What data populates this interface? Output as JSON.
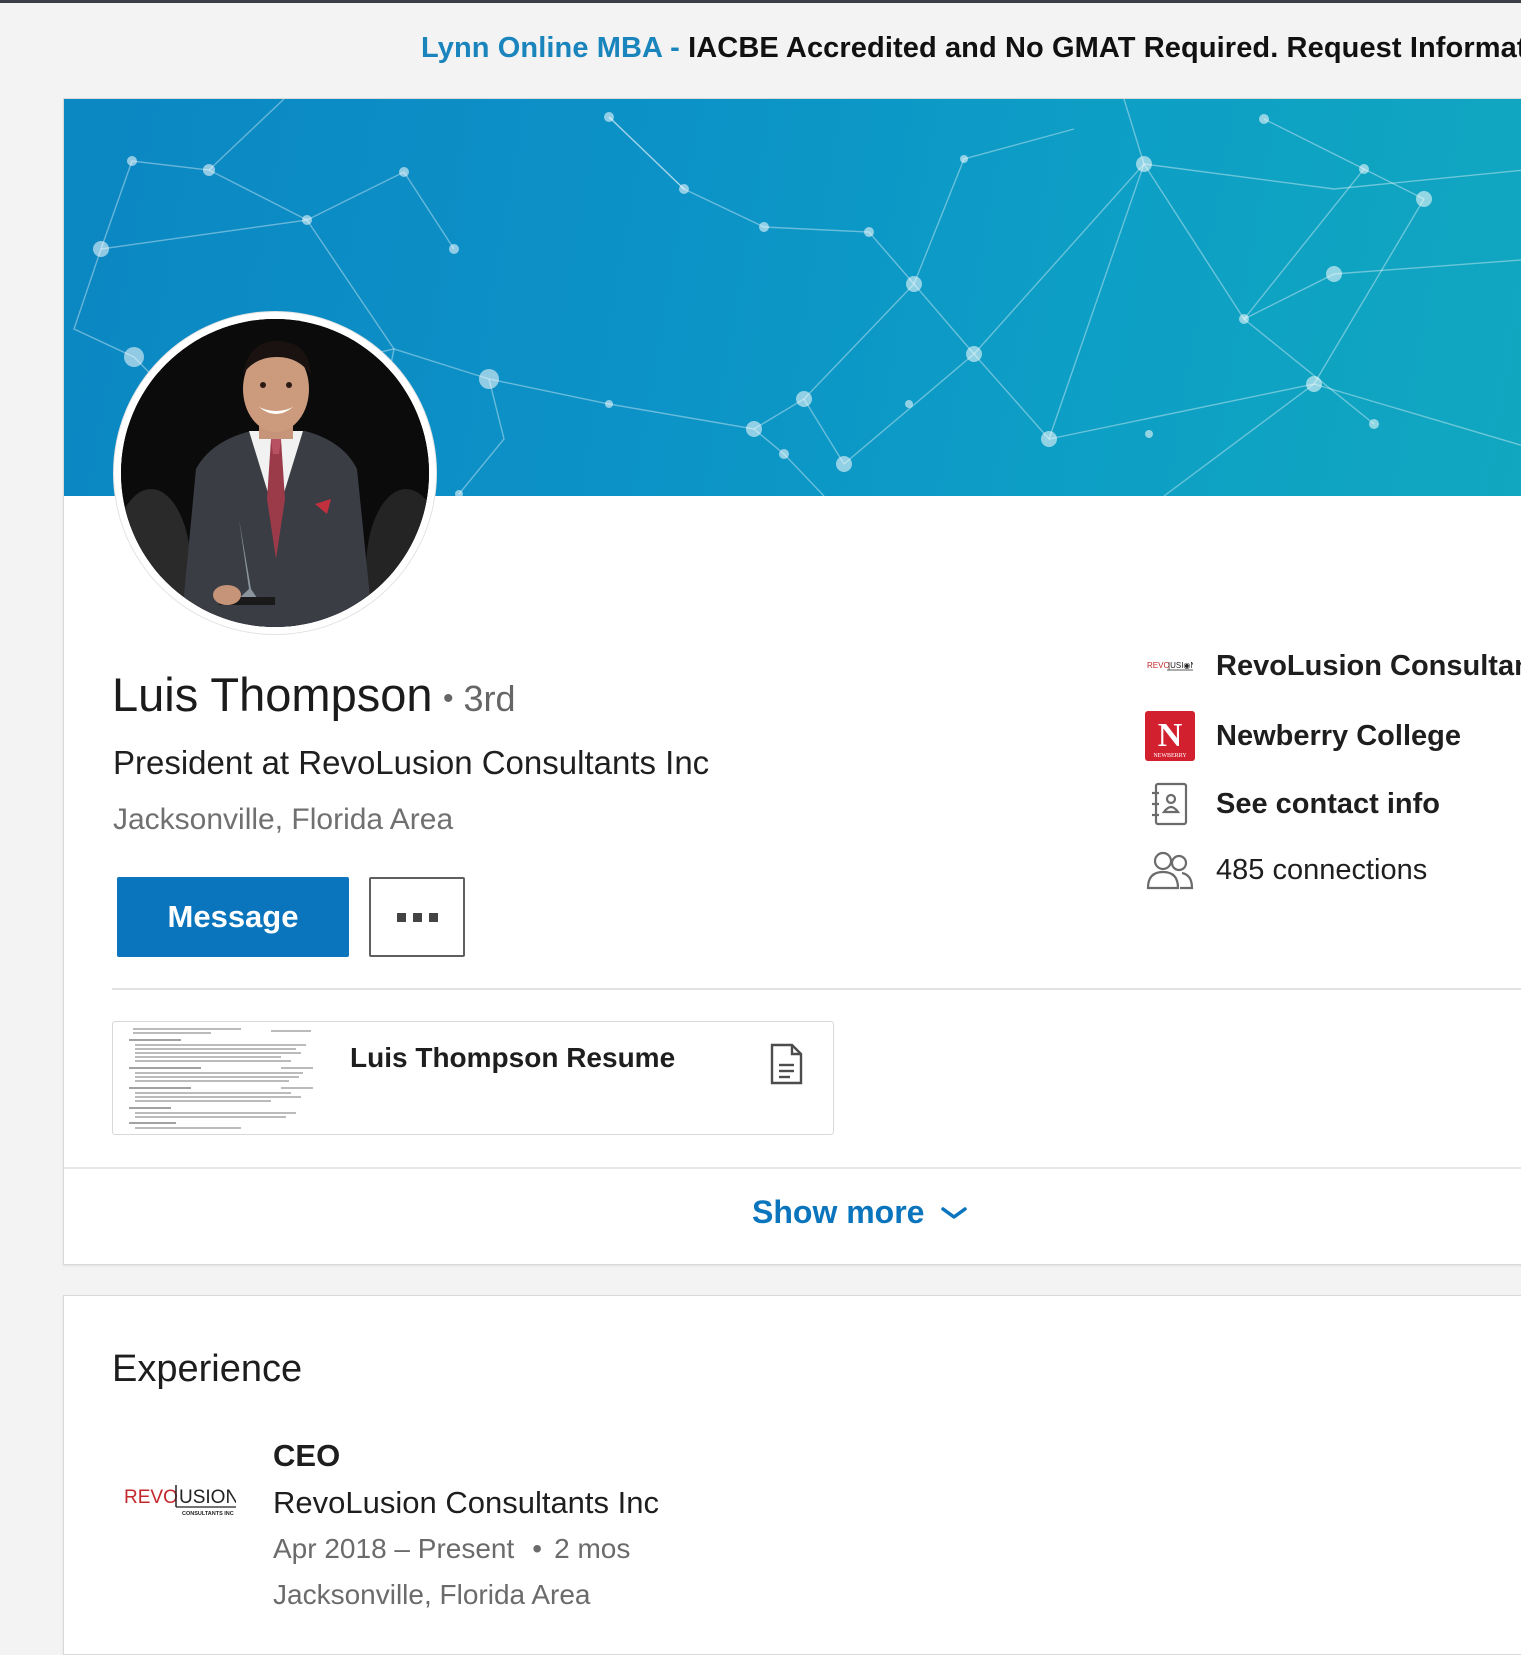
{
  "ad": {
    "link_text": "Lynn Online MBA -",
    "text": "IACBE Accredited and No GMAT Required. Request Information"
  },
  "profile": {
    "name": "Luis Thompson",
    "degree_separator": "•",
    "degree": "3rd",
    "headline": "President at RevoLusion Consultants Inc",
    "location": "Jacksonville, Florida Area",
    "message_label": "Message",
    "more_icon": "more-horizontal-icon"
  },
  "sidebar": {
    "current_company": "RevoLusion Consultants Inc",
    "education": "Newberry College",
    "contact": "See contact info",
    "connections": "485 connections",
    "company_logo_text": "REVO|USION",
    "school_logo_letter": "N",
    "school_logo_caption": "NEWBERRY"
  },
  "document": {
    "title": "Luis Thompson Resume",
    "icon": "document-icon"
  },
  "show_more": {
    "label": "Show more",
    "icon": "chevron-down-icon"
  },
  "experience": {
    "section_title": "Experience",
    "items": [
      {
        "role": "CEO",
        "company": "RevoLusion Consultants Inc",
        "dates": "Apr 2018 – Present",
        "date_separator": "•",
        "duration": "2 mos",
        "location": "Jacksonville, Florida Area",
        "logo_text_red": "REVO",
        "logo_text_dark": "USION",
        "logo_caption": "CONSULTANTS INC"
      }
    ]
  },
  "colors": {
    "accent": "#0a74bc",
    "link": "#1a84bd",
    "banner": "#0c92c7",
    "school_red": "#d3202f",
    "brand_red": "#c3272b"
  }
}
